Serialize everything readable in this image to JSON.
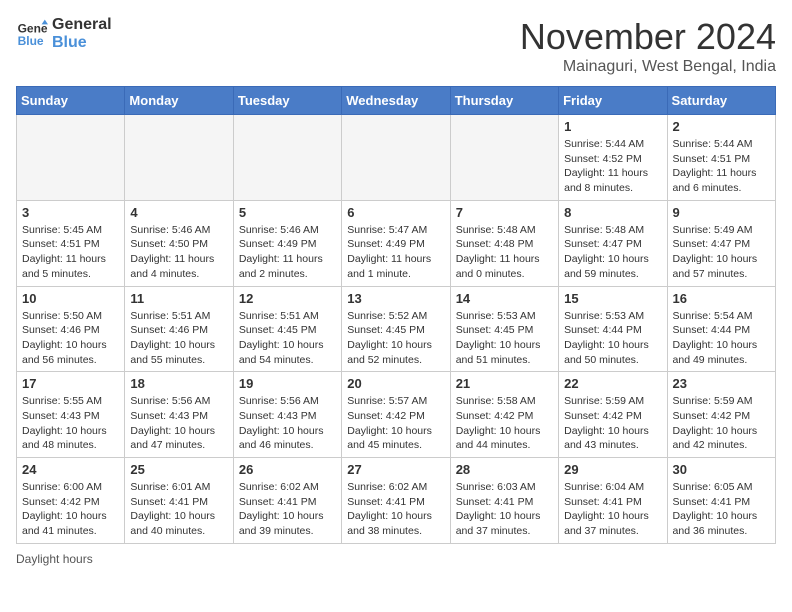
{
  "logo": {
    "line1": "General",
    "line2": "Blue"
  },
  "title": "November 2024",
  "subtitle": "Mainaguri, West Bengal, India",
  "weekdays": [
    "Sunday",
    "Monday",
    "Tuesday",
    "Wednesday",
    "Thursday",
    "Friday",
    "Saturday"
  ],
  "weeks": [
    [
      {
        "day": "",
        "info": ""
      },
      {
        "day": "",
        "info": ""
      },
      {
        "day": "",
        "info": ""
      },
      {
        "day": "",
        "info": ""
      },
      {
        "day": "",
        "info": ""
      },
      {
        "day": "1",
        "info": "Sunrise: 5:44 AM\nSunset: 4:52 PM\nDaylight: 11 hours and 8 minutes."
      },
      {
        "day": "2",
        "info": "Sunrise: 5:44 AM\nSunset: 4:51 PM\nDaylight: 11 hours and 6 minutes."
      }
    ],
    [
      {
        "day": "3",
        "info": "Sunrise: 5:45 AM\nSunset: 4:51 PM\nDaylight: 11 hours and 5 minutes."
      },
      {
        "day": "4",
        "info": "Sunrise: 5:46 AM\nSunset: 4:50 PM\nDaylight: 11 hours and 4 minutes."
      },
      {
        "day": "5",
        "info": "Sunrise: 5:46 AM\nSunset: 4:49 PM\nDaylight: 11 hours and 2 minutes."
      },
      {
        "day": "6",
        "info": "Sunrise: 5:47 AM\nSunset: 4:49 PM\nDaylight: 11 hours and 1 minute."
      },
      {
        "day": "7",
        "info": "Sunrise: 5:48 AM\nSunset: 4:48 PM\nDaylight: 11 hours and 0 minutes."
      },
      {
        "day": "8",
        "info": "Sunrise: 5:48 AM\nSunset: 4:47 PM\nDaylight: 10 hours and 59 minutes."
      },
      {
        "day": "9",
        "info": "Sunrise: 5:49 AM\nSunset: 4:47 PM\nDaylight: 10 hours and 57 minutes."
      }
    ],
    [
      {
        "day": "10",
        "info": "Sunrise: 5:50 AM\nSunset: 4:46 PM\nDaylight: 10 hours and 56 minutes."
      },
      {
        "day": "11",
        "info": "Sunrise: 5:51 AM\nSunset: 4:46 PM\nDaylight: 10 hours and 55 minutes."
      },
      {
        "day": "12",
        "info": "Sunrise: 5:51 AM\nSunset: 4:45 PM\nDaylight: 10 hours and 54 minutes."
      },
      {
        "day": "13",
        "info": "Sunrise: 5:52 AM\nSunset: 4:45 PM\nDaylight: 10 hours and 52 minutes."
      },
      {
        "day": "14",
        "info": "Sunrise: 5:53 AM\nSunset: 4:45 PM\nDaylight: 10 hours and 51 minutes."
      },
      {
        "day": "15",
        "info": "Sunrise: 5:53 AM\nSunset: 4:44 PM\nDaylight: 10 hours and 50 minutes."
      },
      {
        "day": "16",
        "info": "Sunrise: 5:54 AM\nSunset: 4:44 PM\nDaylight: 10 hours and 49 minutes."
      }
    ],
    [
      {
        "day": "17",
        "info": "Sunrise: 5:55 AM\nSunset: 4:43 PM\nDaylight: 10 hours and 48 minutes."
      },
      {
        "day": "18",
        "info": "Sunrise: 5:56 AM\nSunset: 4:43 PM\nDaylight: 10 hours and 47 minutes."
      },
      {
        "day": "19",
        "info": "Sunrise: 5:56 AM\nSunset: 4:43 PM\nDaylight: 10 hours and 46 minutes."
      },
      {
        "day": "20",
        "info": "Sunrise: 5:57 AM\nSunset: 4:42 PM\nDaylight: 10 hours and 45 minutes."
      },
      {
        "day": "21",
        "info": "Sunrise: 5:58 AM\nSunset: 4:42 PM\nDaylight: 10 hours and 44 minutes."
      },
      {
        "day": "22",
        "info": "Sunrise: 5:59 AM\nSunset: 4:42 PM\nDaylight: 10 hours and 43 minutes."
      },
      {
        "day": "23",
        "info": "Sunrise: 5:59 AM\nSunset: 4:42 PM\nDaylight: 10 hours and 42 minutes."
      }
    ],
    [
      {
        "day": "24",
        "info": "Sunrise: 6:00 AM\nSunset: 4:42 PM\nDaylight: 10 hours and 41 minutes."
      },
      {
        "day": "25",
        "info": "Sunrise: 6:01 AM\nSunset: 4:41 PM\nDaylight: 10 hours and 40 minutes."
      },
      {
        "day": "26",
        "info": "Sunrise: 6:02 AM\nSunset: 4:41 PM\nDaylight: 10 hours and 39 minutes."
      },
      {
        "day": "27",
        "info": "Sunrise: 6:02 AM\nSunset: 4:41 PM\nDaylight: 10 hours and 38 minutes."
      },
      {
        "day": "28",
        "info": "Sunrise: 6:03 AM\nSunset: 4:41 PM\nDaylight: 10 hours and 37 minutes."
      },
      {
        "day": "29",
        "info": "Sunrise: 6:04 AM\nSunset: 4:41 PM\nDaylight: 10 hours and 37 minutes."
      },
      {
        "day": "30",
        "info": "Sunrise: 6:05 AM\nSunset: 4:41 PM\nDaylight: 10 hours and 36 minutes."
      }
    ]
  ],
  "footer": {
    "daylight_label": "Daylight hours"
  }
}
